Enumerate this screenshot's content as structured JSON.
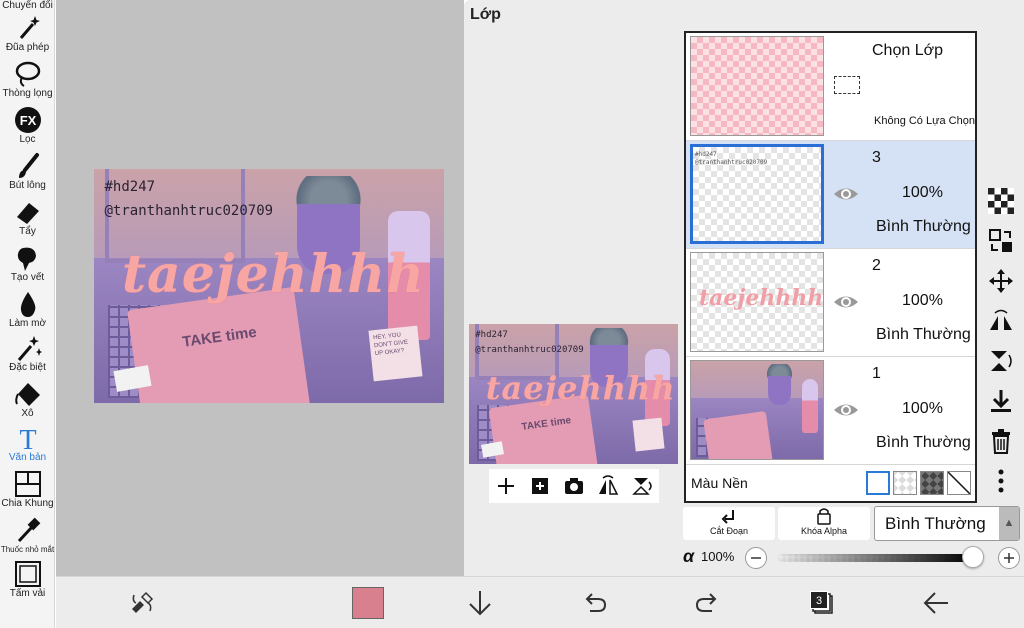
{
  "toolbar": {
    "items": [
      {
        "label": "Chuyển đổi",
        "icon": "transform-icon"
      },
      {
        "label": "Đũa phép",
        "icon": "magic-wand-icon"
      },
      {
        "label": "Thòng lọng",
        "icon": "lasso-icon"
      },
      {
        "label": "Lọc",
        "icon": "filter-fx-icon",
        "icon_text": "FX"
      },
      {
        "label": "Bút lông",
        "icon": "brush-icon"
      },
      {
        "label": "Tẩy",
        "icon": "eraser-icon"
      },
      {
        "label": "Tạo vết",
        "icon": "smudge-icon"
      },
      {
        "label": "Làm mờ",
        "icon": "blur-icon"
      },
      {
        "label": "Đặc biệt",
        "icon": "special-icon"
      },
      {
        "label": "Xô",
        "icon": "bucket-icon"
      },
      {
        "label": "Văn bản",
        "icon": "text-icon",
        "icon_text": "T",
        "active": true
      },
      {
        "label": "Chia Khung",
        "icon": "frame-divider-icon"
      },
      {
        "label": "Thuốc nhỏ mắt",
        "icon": "eyedropper-icon"
      },
      {
        "label": "Tấm vải",
        "icon": "canvas-icon"
      }
    ]
  },
  "artwork": {
    "tag": "#hd247",
    "handle": "@tranthanhtruc020709",
    "title": "taejehhhh",
    "notebook_text": "TAKE time",
    "note_text": "HEY, YOU DON'T GIVE UP OKAY?"
  },
  "layer_panel": {
    "title": "Lớp",
    "selection_layer": {
      "title": "Chọn Lớp",
      "status": "Không Có Lựa Chọn"
    },
    "layers": [
      {
        "number": "3",
        "opacity": "100%",
        "blend": "Bình Thường",
        "selected": true,
        "thumb_tag": "#hd247",
        "thumb_handle": "@tranthanhtruc020709"
      },
      {
        "number": "2",
        "opacity": "100%",
        "blend": "Bình Thường",
        "selected": false,
        "thumb_script": "taejehhhh"
      },
      {
        "number": "1",
        "opacity": "100%",
        "blend": "Bình Thường",
        "selected": false
      }
    ],
    "background": {
      "label": "Màu Nền",
      "swatches": [
        "white",
        "transparent-checker",
        "dark-checker",
        "diagonal-none"
      ]
    },
    "mini_tools": [
      "+",
      "add-layer-icon",
      "camera-icon",
      "flip-icon",
      "merge-icon"
    ],
    "clip_button": "Cắt Đoạn",
    "alpha_lock_button": "Khóa Alpha",
    "blend_mode": "Bình Thường",
    "alpha_symbol": "α",
    "alpha_value": "100%",
    "alpha_fraction": 1.0
  },
  "bottom_bar": {
    "current_color": "#d8808e",
    "layer_count": "3"
  },
  "colors": {
    "accent": "#2a7bd6",
    "canvas_bg": "#c1c1c1",
    "selected_layer": "#d5e1f4"
  }
}
